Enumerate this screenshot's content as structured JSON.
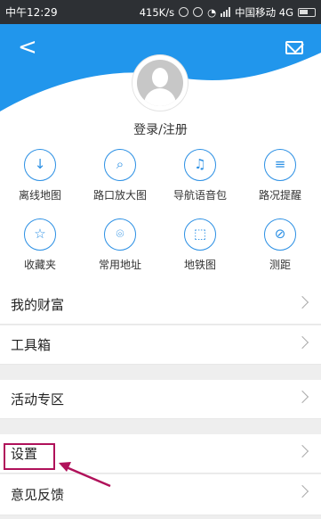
{
  "statusbar": {
    "time": "中午12:29",
    "speed": "415K/s",
    "carrier": "中国移动 4G"
  },
  "header": {
    "back_label": "<",
    "login_label": "登录/注册"
  },
  "grid": [
    {
      "label": "离线地图",
      "icon": "download-map-icon",
      "glyph": "↓"
    },
    {
      "label": "路口放大图",
      "icon": "zoom-junction-icon",
      "glyph": "⌕"
    },
    {
      "label": "导航语音包",
      "icon": "voice-pack-icon",
      "glyph": "♫"
    },
    {
      "label": "路况提醒",
      "icon": "traffic-alert-icon",
      "glyph": "≡"
    },
    {
      "label": "收藏夹",
      "icon": "star-icon",
      "glyph": "☆"
    },
    {
      "label": "常用地址",
      "icon": "location-pin-icon",
      "glyph": "⌾"
    },
    {
      "label": "地铁图",
      "icon": "subway-map-icon",
      "glyph": "⬚"
    },
    {
      "label": "测距",
      "icon": "ruler-icon",
      "glyph": "⊘"
    }
  ],
  "menu": {
    "wealth": "我的财富",
    "tools": "工具箱",
    "activities": "活动专区",
    "settings": "设置",
    "feedback": "意见反馈"
  },
  "colors": {
    "accent": "#2196ec",
    "highlight": "#b0115a"
  }
}
